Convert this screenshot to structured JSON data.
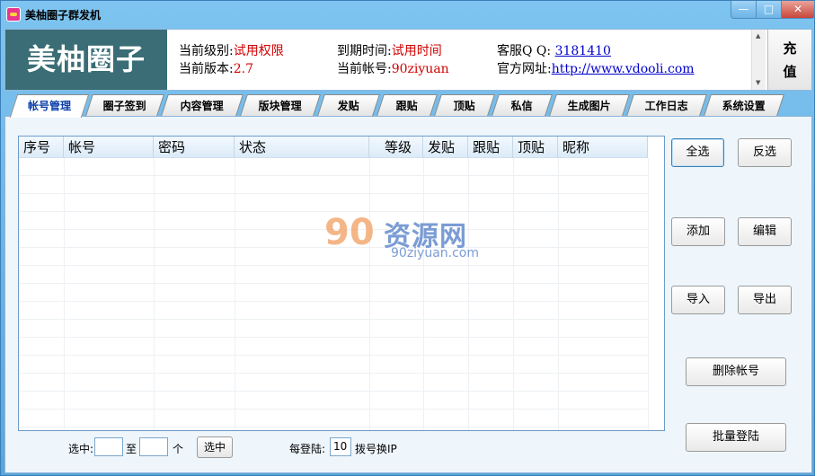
{
  "window": {
    "title": "美柚圈子群发机"
  },
  "header": {
    "brand": "美柚圈子",
    "level_label": "当前级别:",
    "level_value": "试用权限",
    "version_label": "当前版本:",
    "version_value": "2.7",
    "expire_label": "到期时间:",
    "expire_value": "试用时间",
    "account_label": "当前帐号:",
    "account_value": "90ziyuan",
    "qq_label": "客服Q Q: ",
    "qq_value": "3181410",
    "site_label": "官方网址:",
    "site_value": "http://www.vdooli.com",
    "recharge_line1": "充",
    "recharge_line2": "值"
  },
  "tabs": [
    "帐号管理",
    "圈子签到",
    "内容管理",
    "版块管理",
    "发贴",
    "跟贴",
    "顶贴",
    "私信",
    "生成图片",
    "工作日志",
    "系统设置"
  ],
  "active_tab": 0,
  "table": {
    "columns": [
      "序号",
      "帐号",
      "密码",
      "状态",
      "等级",
      "发贴",
      "跟贴",
      "顶贴",
      "昵称"
    ],
    "rows": []
  },
  "watermark": {
    "logo": "90",
    "cn": "资源网",
    "en": "90ziyuan.com"
  },
  "buttons": {
    "select_all": "全选",
    "invert": "反选",
    "add": "添加",
    "edit": "编辑",
    "import": "导入",
    "export": "导出",
    "delete_account": "删除帐号",
    "batch_login": "批量登陆"
  },
  "bottom": {
    "select_label": "选中:",
    "to_label": "至",
    "unit_label": "个",
    "select_btn": "选中",
    "per_login_label": "每登陆:",
    "per_login_value": "10",
    "suffix": "拨号换IP"
  }
}
